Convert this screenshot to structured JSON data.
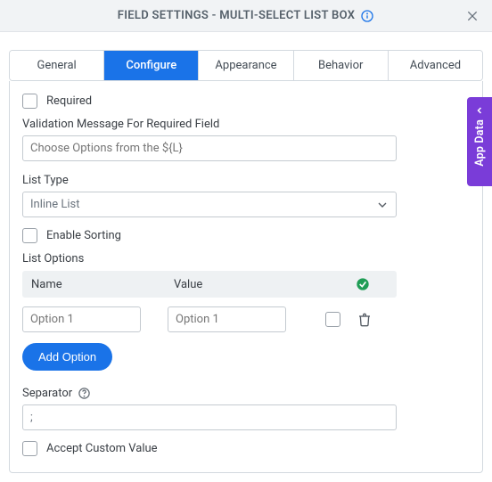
{
  "header": {
    "title": "FIELD SETTINGS - MULTI-SELECT LIST BOX"
  },
  "tabs": [
    {
      "label": "General"
    },
    {
      "label": "Configure"
    },
    {
      "label": "Appearance"
    },
    {
      "label": "Behavior"
    },
    {
      "label": "Advanced"
    }
  ],
  "sideTab": {
    "label": "App Data"
  },
  "form": {
    "required_label": "Required",
    "validation_label": "Validation Message For Required Field",
    "validation_placeholder": "Choose Options from the ${L}",
    "list_type_label": "List Type",
    "list_type_value": "Inline List",
    "enable_sorting_label": "Enable Sorting",
    "list_options_label": "List Options",
    "col_name": "Name",
    "col_value": "Value",
    "row": {
      "name_placeholder": "Option 1",
      "value_placeholder": "Option 1"
    },
    "add_option_label": "Add Option",
    "separator_label": "Separator",
    "separator_value": ";",
    "accept_custom_label": "Accept Custom Value"
  }
}
